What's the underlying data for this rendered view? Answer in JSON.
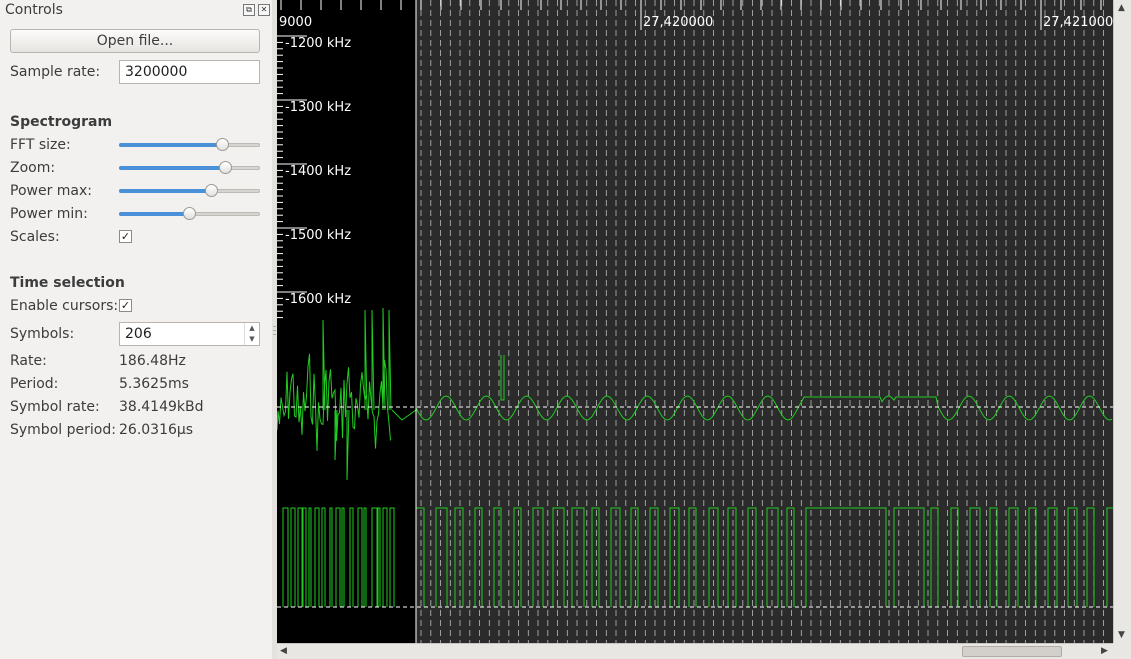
{
  "dock": {
    "title": "Controls",
    "float_glyph": "⧉",
    "close_glyph": "✕",
    "open_file_label": "Open file...",
    "sample_rate_label": "Sample rate:",
    "sample_rate_value": "3200000",
    "spectrogram_header": "Spectrogram",
    "fft_size_label": "FFT size:",
    "zoom_label": "Zoom:",
    "power_max_label": "Power max:",
    "power_min_label": "Power min:",
    "scales_label": "Scales:",
    "scales_checked": "✓",
    "time_selection_header": "Time selection",
    "enable_cursors_label": "Enable cursors:",
    "enable_cursors_checked": "✓",
    "symbols_label": "Symbols:",
    "symbols_value": "206",
    "rate_label": "Rate:",
    "rate_value": "186.48Hz",
    "period_label": "Period:",
    "period_value": "5.3625ms",
    "symbol_rate_label": "Symbol rate:",
    "symbol_rate_value": "38.4149kBd",
    "symbol_period_label": "Symbol period:",
    "symbol_period_value": "26.0316µs",
    "sliders": {
      "fft_size": 0.76,
      "zoom": 0.78,
      "power_max": 0.67,
      "power_min": 0.5
    }
  },
  "plot": {
    "time_ticks": [
      "9000",
      "27,420000",
      "27,421000"
    ],
    "freq_labels": [
      "-1200 kHz",
      "-1300 kHz",
      "-1400 kHz",
      "-1500 kHz",
      "-1600 kHz"
    ],
    "colors": {
      "background": "#000000",
      "signal": "#22cc22",
      "cursor": "#ffffff",
      "grid": "#bbbbbb",
      "bg_after_cursor": "#2b2b2b"
    }
  },
  "scroll": {
    "up_arrow": "▲",
    "down_arrow": "▼",
    "left_arrow": "◀",
    "right_arrow": "▶"
  }
}
